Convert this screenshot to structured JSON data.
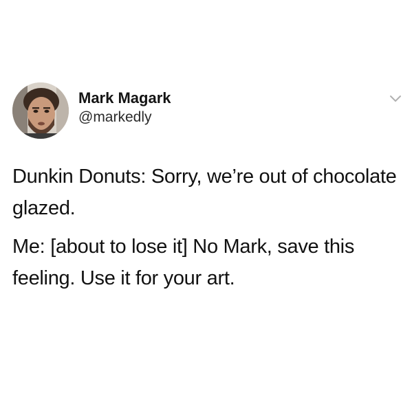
{
  "tweet": {
    "author": {
      "display_name": "Mark Magark",
      "handle": "@markedly",
      "avatar_icon": "profile-photo"
    },
    "menu_icon": "chevron-down-icon",
    "paragraphs": [
      "Dunkin Donuts: Sorry, we’re out of chocolate glazed.",
      "Me: [about to lose it] No Mark, save this feeling. Use it for your art."
    ]
  },
  "colors": {
    "background": "#ffffff",
    "text": "#111111",
    "caret": "#b0b0b0"
  }
}
